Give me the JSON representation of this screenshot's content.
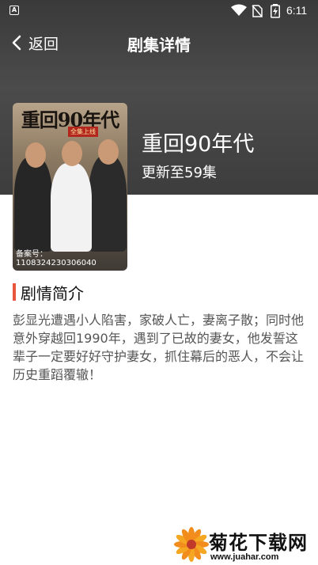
{
  "status_bar": {
    "notification_label": "A",
    "time": "6:11",
    "icons": [
      "notification-icon",
      "wifi-icon",
      "no-sim-icon",
      "battery-charging-icon"
    ]
  },
  "nav": {
    "back_label": "返回",
    "title": "剧集详情"
  },
  "poster": {
    "title": "重回90年代",
    "subtitle": "全集上线",
    "registration": "备案号：1108324230306040"
  },
  "show": {
    "title": "重回90年代",
    "update_status": "更新至59集"
  },
  "synopsis": {
    "heading": "剧情简介",
    "text": "彭显光遭遇小人陷害，家破人亡，妻离子散；同时他意外穿越回1990年，遇到了已故的妻女，他发誓这辈子一定要好好守护妻女，抓住幕后的恶人，不会让历史重蹈覆辙！"
  },
  "watermark": {
    "text": "菊花下载网",
    "url": "www.juahar.com"
  },
  "colors": {
    "header_bg": "#444444",
    "accent": "#e8563f",
    "body_text": "#555555"
  }
}
